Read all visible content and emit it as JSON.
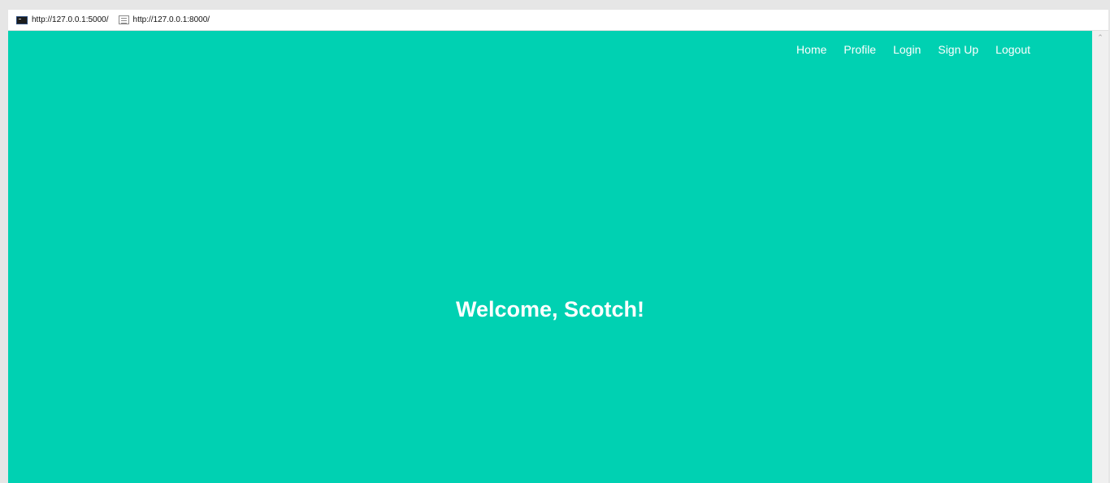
{
  "bookmarks": [
    {
      "label": "http://127.0.0.1:5000/",
      "icon": "terminal-icon"
    },
    {
      "label": "http://127.0.0.1:8000/",
      "icon": "page-icon"
    }
  ],
  "nav": {
    "items": [
      "Home",
      "Profile",
      "Login",
      "Sign Up",
      "Logout"
    ]
  },
  "hero": {
    "heading": "Welcome, Scotch!"
  },
  "colors": {
    "hero_background": "#00d1b2",
    "text": "#ffffff"
  }
}
